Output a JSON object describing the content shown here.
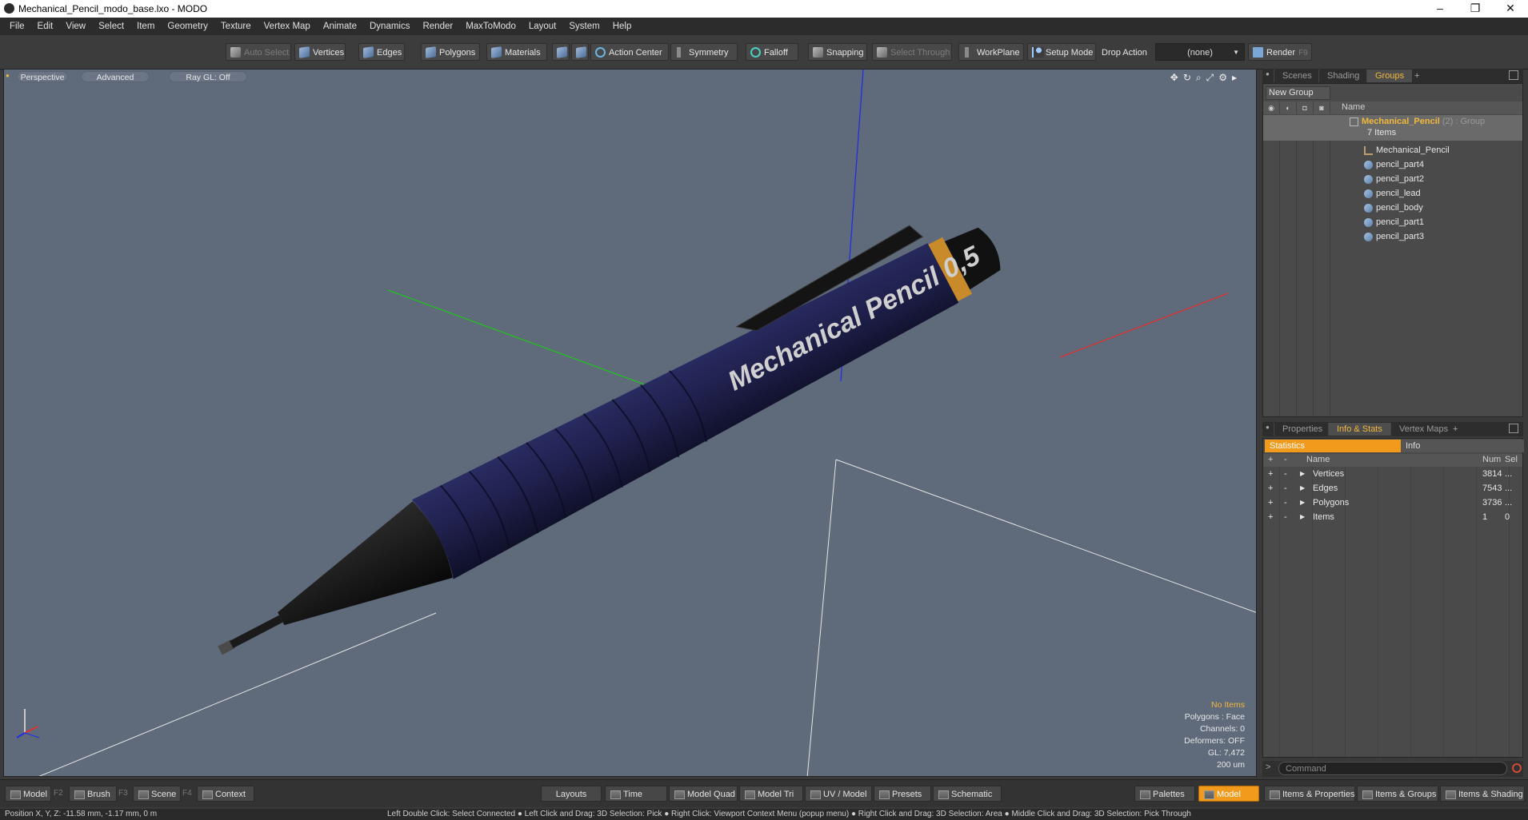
{
  "window": {
    "title": "Mechanical_Pencil_modo_base.lxo - MODO",
    "minimize": "–",
    "restore": "❐",
    "close": "✕"
  },
  "menu": [
    "File",
    "Edit",
    "View",
    "Select",
    "Item",
    "Geometry",
    "Texture",
    "Vertex Map",
    "Animate",
    "Dynamics",
    "Render",
    "MaxToModo",
    "Layout",
    "System",
    "Help"
  ],
  "toolbar": {
    "auto_select": "Auto Select",
    "vertices": "Vertices",
    "edges": "Edges",
    "polygons": "Polygons",
    "materials": "Materials",
    "action_center": "Action Center",
    "symmetry": "Symmetry",
    "falloff": "Falloff",
    "snapping": "Snapping",
    "select_through": "Select Through",
    "workplane": "WorkPlane",
    "setup_mode": "Setup Mode",
    "drop_action_label": "Drop Action",
    "drop_action_value": "(none)",
    "render": "Render",
    "render_key": "F9"
  },
  "viewport": {
    "view_mode": "Perspective",
    "shading": "Advanced",
    "raygl": "Ray GL: Off",
    "model_text": "Mechanical Pencil 0,5",
    "info": {
      "items": "No Items",
      "polygons": "Polygons : Face",
      "channels": "Channels: 0",
      "deformers": "Deformers: OFF",
      "gl": "GL: 7,472",
      "scale": "200 um"
    }
  },
  "colors": {
    "accent": "#f1b83d",
    "active_button": "#f19a1b",
    "viewport_bg": "#5f6a7a",
    "pencil_body": "#1e1f4a",
    "axis_x": "#e03030",
    "axis_y": "#22c022",
    "axis_z": "#2030e0"
  },
  "scene_panel": {
    "tabs": [
      "Scenes",
      "Shading",
      "Groups"
    ],
    "active_tab": "Groups",
    "new_group": "New Group",
    "column_name": "Name",
    "group": {
      "name": "Mechanical_Pencil",
      "count": "(2) : Group",
      "items_count": "7 Items"
    },
    "items": [
      "Mechanical_Pencil",
      "pencil_part4",
      "pencil_part2",
      "pencil_lead",
      "pencil_body",
      "pencil_part1",
      "pencil_part3"
    ]
  },
  "info_panel": {
    "tabs": [
      "Properties",
      "Info & Stats",
      "Vertex Maps"
    ],
    "active_tab": "Info & Stats",
    "subtabs": [
      "Statistics",
      "Info"
    ],
    "columns": {
      "name": "Name",
      "num": "Num",
      "sel": "Sel"
    },
    "rows": [
      {
        "name": "Vertices",
        "num": "3814",
        "sel": "..."
      },
      {
        "name": "Edges",
        "num": "7543",
        "sel": "..."
      },
      {
        "name": "Polygons",
        "num": "3736",
        "sel": "..."
      },
      {
        "name": "Items",
        "num": "1",
        "sel": "0"
      }
    ]
  },
  "command": {
    "prompt": ">",
    "placeholder": "Command"
  },
  "bottombar": {
    "model": "Model",
    "model_key": "F2",
    "brush": "Brush",
    "brush_key": "F3",
    "scene": "Scene",
    "scene_key": "F4",
    "context": "Context",
    "layouts": "Layouts",
    "time": "Time",
    "model_quad": "Model Quad",
    "model_tri": "Model Tri",
    "uv_model": "UV / Model",
    "presets": "Presets",
    "schematic": "Schematic",
    "palettes": "Palettes",
    "model_active": "Model",
    "items_properties": "Items & Properties",
    "items_groups": "Items & Groups",
    "items_shading": "Items & Shading"
  },
  "status": {
    "position": "Position X, Y, Z:  -11.58 mm, -1.17 mm, 0 m",
    "hints": "Left Double Click: Select Connected ● Left Click and Drag: 3D Selection: Pick ● Right Click: Viewport Context Menu (popup menu) ● Right Click and Drag: 3D Selection: Area ● Middle Click and Drag: 3D Selection: Pick Through"
  }
}
